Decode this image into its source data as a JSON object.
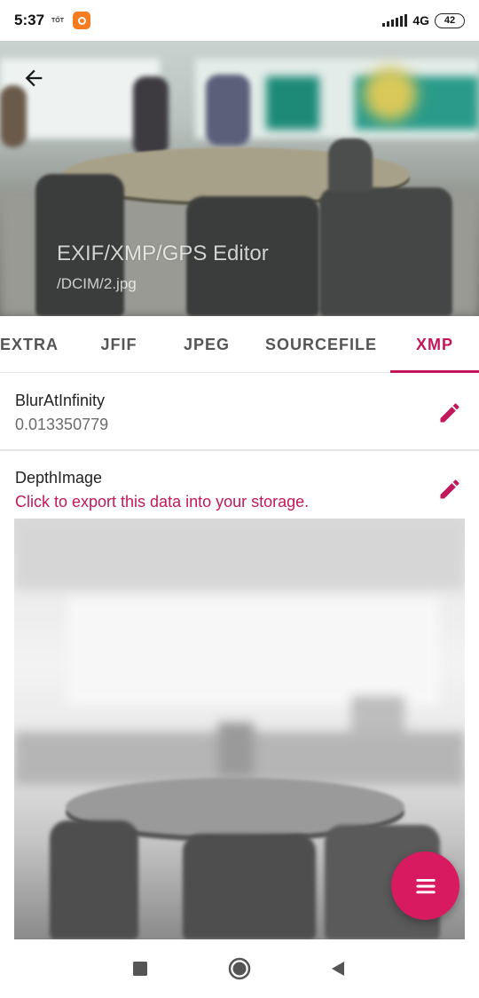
{
  "status_bar": {
    "time": "5:37",
    "carrier": "TỐT",
    "network": "4G",
    "battery": "42",
    "app_icon": "orange-app-notification-icon"
  },
  "header": {
    "title": "EXIF/XMP/GPS Editor",
    "subtitle": "/DCIM/2.jpg",
    "back_icon": "arrow-left-icon"
  },
  "tabs": [
    {
      "label": "EXTRA",
      "active": false
    },
    {
      "label": "JFIF",
      "active": false
    },
    {
      "label": "JPEG",
      "active": false
    },
    {
      "label": "SOURCEFILE",
      "active": false
    },
    {
      "label": "XMP",
      "active": true
    }
  ],
  "fields": [
    {
      "name": "BlurAtInfinity",
      "value": "0.013350779"
    },
    {
      "name": "DepthImage",
      "link": "Click to export this data into your storage."
    }
  ],
  "colors": {
    "accent": "#c2185b",
    "fab": "#d81b60",
    "text_primary": "#222222",
    "text_secondary": "#6b6b6b"
  },
  "fab": {
    "icon": "menu-icon"
  },
  "nav_bar": {
    "icons": [
      "recents-square-icon",
      "home-circle-icon",
      "back-triangle-icon"
    ]
  }
}
